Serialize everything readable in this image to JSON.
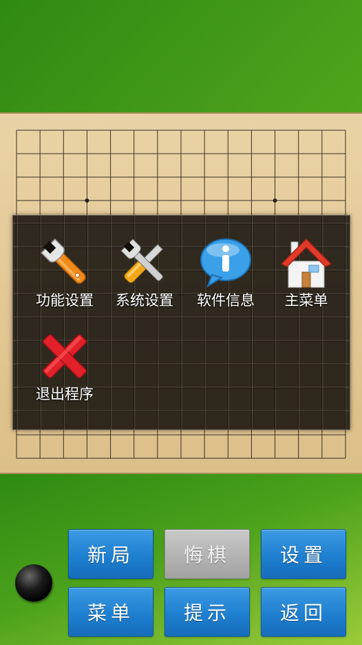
{
  "menu": {
    "items": [
      {
        "label": "功能设置",
        "icon": "wrench-icon"
      },
      {
        "label": "系统设置",
        "icon": "tools-icon"
      },
      {
        "label": "软件信息",
        "icon": "info-icon"
      },
      {
        "label": "主菜单",
        "icon": "home-icon"
      },
      {
        "label": "退出程序",
        "icon": "close-x-icon"
      }
    ]
  },
  "toolbar": {
    "new_game": "新局",
    "undo": "悔棋",
    "settings": "设置",
    "menu": "菜单",
    "hint": "提示",
    "back": "返回"
  },
  "state": {
    "undo_enabled": false,
    "current_player_stone": "black"
  },
  "colors": {
    "button_blue": "#1f7fd0",
    "button_disabled": "#b3b3b3",
    "board_wood": "#e3c895",
    "background_green": "#4fa31c"
  }
}
